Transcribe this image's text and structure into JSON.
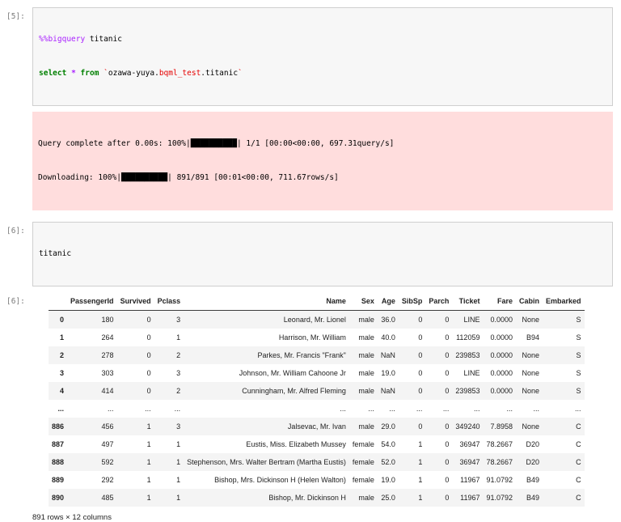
{
  "notebook": {
    "cell1": {
      "prompt": "[5]:",
      "lines": [
        [
          {
            "text": "%%bigquery",
            "style": "magic"
          },
          {
            "text": " titanic",
            "style": "plain"
          }
        ],
        [
          {
            "text": "select",
            "style": "keyword"
          },
          {
            "text": " ",
            "style": "plain"
          },
          {
            "text": "*",
            "style": "operator"
          },
          {
            "text": " ",
            "style": "plain"
          },
          {
            "text": "from",
            "style": "keyword"
          },
          {
            "text": " ",
            "style": "plain"
          },
          {
            "text": "`",
            "style": "error"
          },
          {
            "text": "ozawa-yuya.",
            "style": "plain"
          },
          {
            "text": "bqml_test",
            "style": "error"
          },
          {
            "text": ".titanic",
            "style": "plain"
          },
          {
            "text": "`",
            "style": "error"
          }
        ]
      ],
      "stderr_lines": [
        "Query complete after 0.00s: 100%|██████████| 1/1 [00:00<00:00, 697.31query/s]",
        "Downloading: 100%|██████████| 891/891 [00:01<00:00, 711.67rows/s]"
      ]
    },
    "cell2": {
      "prompt": "[6]:",
      "output_prompt": "[6]:",
      "lines": [
        [
          {
            "text": "titanic",
            "style": "plain"
          }
        ]
      ]
    }
  },
  "table": {
    "columns": [
      "PassengerId",
      "Survived",
      "Pclass",
      "Name",
      "Sex",
      "Age",
      "SibSp",
      "Parch",
      "Ticket",
      "Fare",
      "Cabin",
      "Embarked"
    ],
    "rows": [
      {
        "index": "0",
        "cells": [
          "180",
          "0",
          "3",
          "Leonard, Mr. Lionel",
          "male",
          "36.0",
          "0",
          "0",
          "LINE",
          "0.0000",
          "None",
          "S"
        ]
      },
      {
        "index": "1",
        "cells": [
          "264",
          "0",
          "1",
          "Harrison, Mr. William",
          "male",
          "40.0",
          "0",
          "0",
          "112059",
          "0.0000",
          "B94",
          "S"
        ]
      },
      {
        "index": "2",
        "cells": [
          "278",
          "0",
          "2",
          "Parkes, Mr. Francis \"Frank\"",
          "male",
          "NaN",
          "0",
          "0",
          "239853",
          "0.0000",
          "None",
          "S"
        ]
      },
      {
        "index": "3",
        "cells": [
          "303",
          "0",
          "3",
          "Johnson, Mr. William Cahoone Jr",
          "male",
          "19.0",
          "0",
          "0",
          "LINE",
          "0.0000",
          "None",
          "S"
        ]
      },
      {
        "index": "4",
        "cells": [
          "414",
          "0",
          "2",
          "Cunningham, Mr. Alfred Fleming",
          "male",
          "NaN",
          "0",
          "0",
          "239853",
          "0.0000",
          "None",
          "S"
        ]
      },
      {
        "index": "...",
        "cells": [
          "...",
          "...",
          "...",
          "...",
          "...",
          "...",
          "...",
          "...",
          "...",
          "...",
          "...",
          "..."
        ]
      },
      {
        "index": "886",
        "cells": [
          "456",
          "1",
          "3",
          "Jalsevac, Mr. Ivan",
          "male",
          "29.0",
          "0",
          "0",
          "349240",
          "7.8958",
          "None",
          "C"
        ]
      },
      {
        "index": "887",
        "cells": [
          "497",
          "1",
          "1",
          "Eustis, Miss. Elizabeth Mussey",
          "female",
          "54.0",
          "1",
          "0",
          "36947",
          "78.2667",
          "D20",
          "C"
        ]
      },
      {
        "index": "888",
        "cells": [
          "592",
          "1",
          "1",
          "Stephenson, Mrs. Walter Bertram (Martha Eustis)",
          "female",
          "52.0",
          "1",
          "0",
          "36947",
          "78.2667",
          "D20",
          "C"
        ]
      },
      {
        "index": "889",
        "cells": [
          "292",
          "1",
          "1",
          "Bishop, Mrs. Dickinson H (Helen Walton)",
          "female",
          "19.0",
          "1",
          "0",
          "11967",
          "91.0792",
          "B49",
          "C"
        ]
      },
      {
        "index": "890",
        "cells": [
          "485",
          "1",
          "1",
          "Bishop, Mr. Dickinson H",
          "male",
          "25.0",
          "1",
          "0",
          "11967",
          "91.0792",
          "B49",
          "C"
        ]
      }
    ],
    "footer": "891 rows × 12 columns"
  }
}
